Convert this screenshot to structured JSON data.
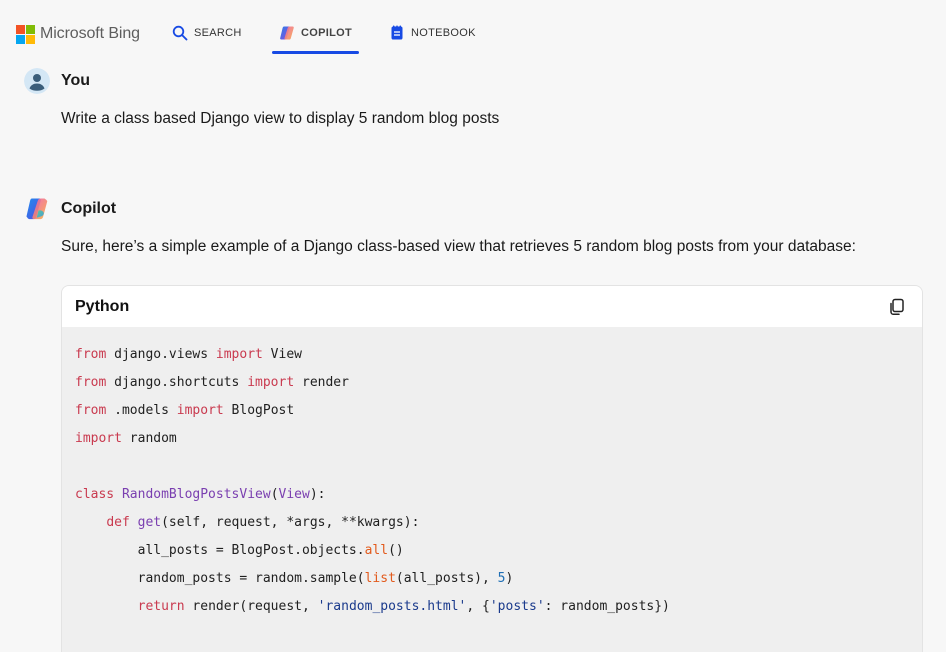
{
  "brand": {
    "name": "Microsoft Bing"
  },
  "nav": {
    "tabs": [
      {
        "label": "SEARCH",
        "active": false
      },
      {
        "label": "COPILOT",
        "active": true
      },
      {
        "label": "NOTEBOOK",
        "active": false
      }
    ]
  },
  "colors": {
    "accent": "#174ae4"
  },
  "conversation": {
    "user": {
      "name": "You",
      "message": "Write a class based Django view to display 5 random blog posts"
    },
    "assistant": {
      "name": "Copilot",
      "message": "Sure, here’s a simple example of a Django class-based view that retrieves 5 random blog posts from your database:"
    }
  },
  "code_block": {
    "language": "Python",
    "copy_icon": "copy-icon",
    "lines": [
      "from django.views import View",
      "from django.shortcuts import render",
      "from .models import BlogPost",
      "import random",
      "",
      "class RandomBlogPostsView(View):",
      "    def get(self, request, *args, **kwargs):",
      "        all_posts = BlogPost.objects.all()",
      "        random_posts = random.sample(list(all_posts), 5)",
      "        return render(request, 'random_posts.html', {'posts': random_posts})"
    ]
  }
}
